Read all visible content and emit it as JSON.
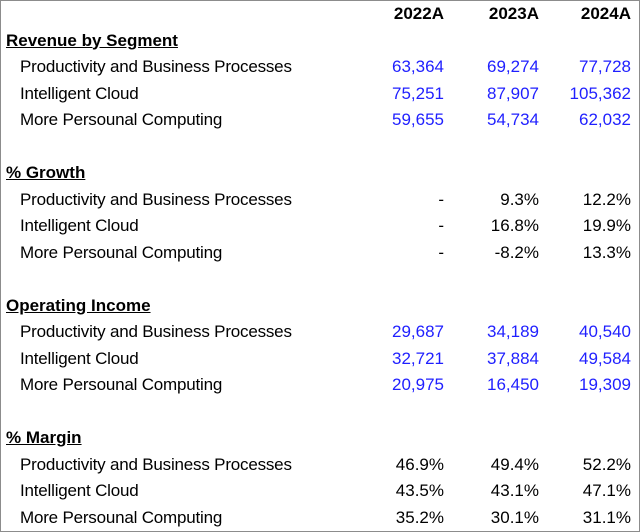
{
  "years": [
    "2022A",
    "2023A",
    "2024A"
  ],
  "colors": {
    "input_blue": "#1f1fff",
    "border": "#8c8c8c"
  },
  "sections": [
    {
      "title": "Revenue by Segment",
      "blue": true,
      "rows": [
        {
          "label": "Productivity and Business Processes",
          "values": [
            "63,364",
            "69,274",
            "77,728"
          ]
        },
        {
          "label": "Intelligent Cloud",
          "values": [
            "75,251",
            "87,907",
            "105,362"
          ]
        },
        {
          "label": "More Persounal Computing",
          "values": [
            "59,655",
            "54,734",
            "62,032"
          ]
        }
      ]
    },
    {
      "title": "% Growth",
      "blue": false,
      "rows": [
        {
          "label": "Productivity and Business Processes",
          "values": [
            "-",
            "9.3%",
            "12.2%"
          ]
        },
        {
          "label": "Intelligent Cloud",
          "values": [
            "-",
            "16.8%",
            "19.9%"
          ]
        },
        {
          "label": "More Persounal Computing",
          "values": [
            "-",
            "-8.2%",
            "13.3%"
          ]
        }
      ]
    },
    {
      "title": "Operating Income",
      "blue": true,
      "rows": [
        {
          "label": "Productivity and Business Processes",
          "values": [
            "29,687",
            "34,189",
            "40,540"
          ]
        },
        {
          "label": "Intelligent Cloud",
          "values": [
            "32,721",
            "37,884",
            "49,584"
          ]
        },
        {
          "label": "More Persounal Computing",
          "values": [
            "20,975",
            "16,450",
            "19,309"
          ]
        }
      ]
    },
    {
      "title": "% Margin",
      "blue": false,
      "rows": [
        {
          "label": "Productivity and Business Processes",
          "values": [
            "46.9%",
            "49.4%",
            "52.2%"
          ]
        },
        {
          "label": "Intelligent Cloud",
          "values": [
            "43.5%",
            "43.1%",
            "47.1%"
          ]
        },
        {
          "label": "More Persounal Computing",
          "values": [
            "35.2%",
            "30.1%",
            "31.1%"
          ]
        }
      ]
    }
  ]
}
